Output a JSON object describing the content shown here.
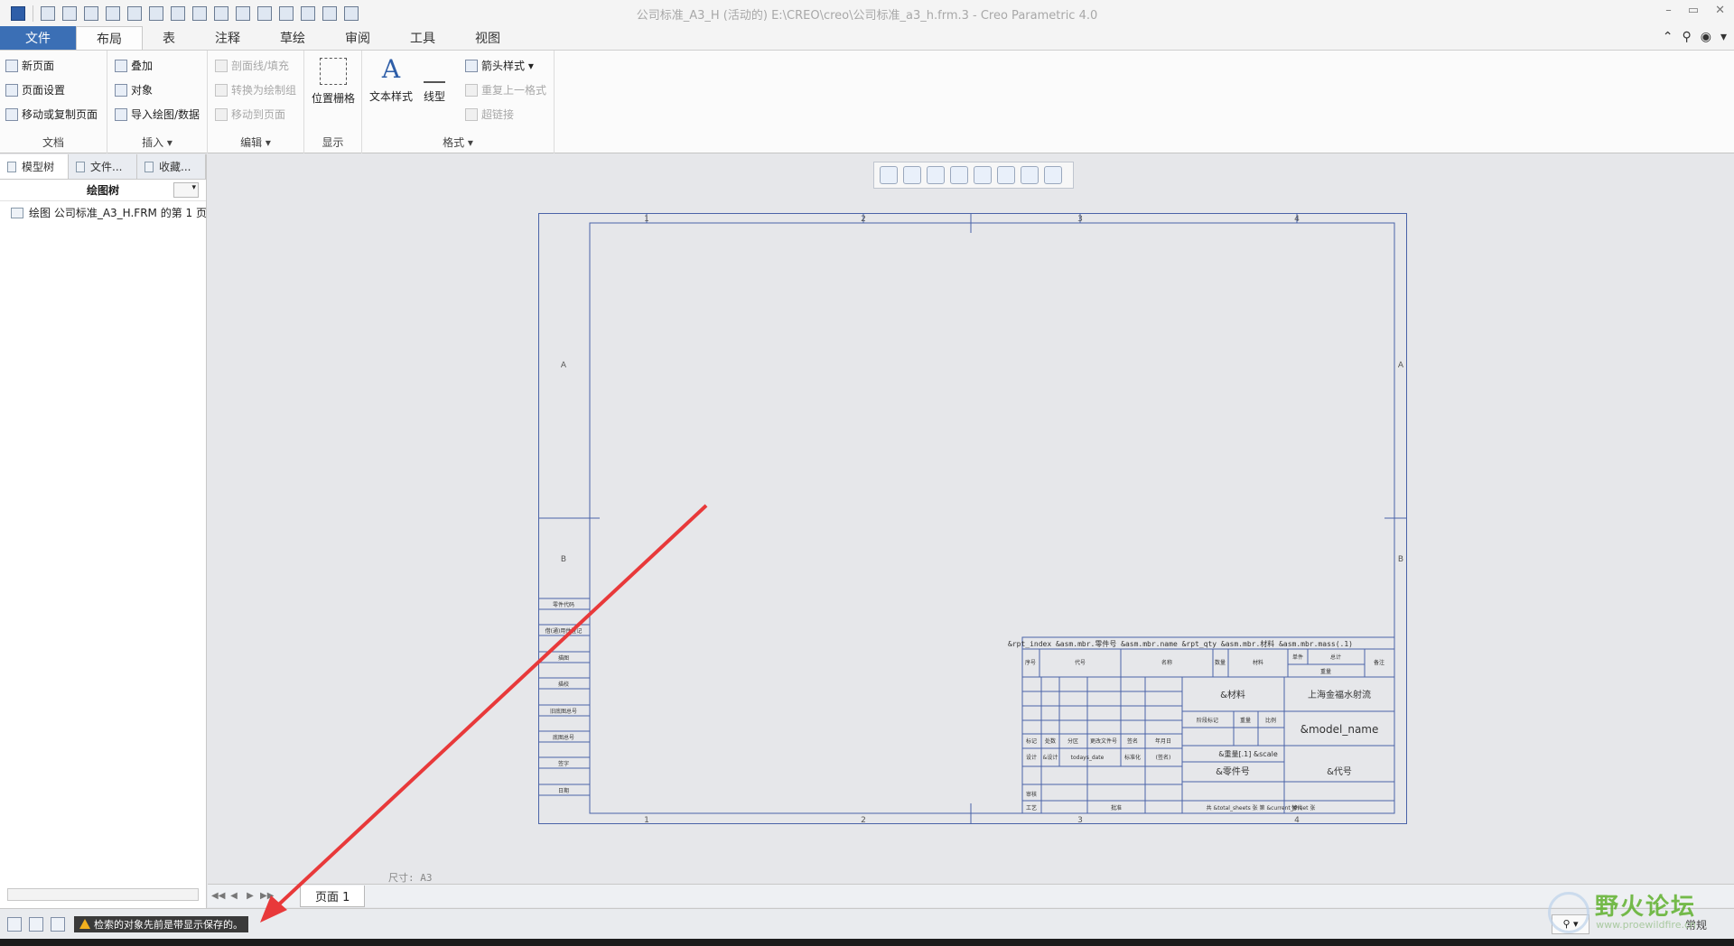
{
  "window": {
    "title": "公司标准_A3_H (活动的) E:\\CREO\\creo\\公司标准_a3_h.frm.3 - Creo Parametric 4.0",
    "buttons": [
      "–",
      "▭",
      "✕"
    ]
  },
  "tabs": [
    {
      "label": "文件"
    },
    {
      "label": "布局"
    },
    {
      "label": "表"
    },
    {
      "label": "注释"
    },
    {
      "label": "草绘"
    },
    {
      "label": "审阅"
    },
    {
      "label": "工具"
    },
    {
      "label": "视图"
    }
  ],
  "ribbon": {
    "doc": {
      "label": "文档",
      "new_page": "新页面",
      "page_setup": "页面设置",
      "move_copy": "移动或复制页面"
    },
    "insert": {
      "label": "插入",
      "overlay": "叠加",
      "object": "对象",
      "import": "导入绘图/数据"
    },
    "edit": {
      "label": "编辑",
      "hatch": "剖面线/填充",
      "convert": "转换为绘制组",
      "move_page": "移动到页面"
    },
    "display": {
      "label": "显示",
      "grid": "位置栅格"
    },
    "format": {
      "label": "格式",
      "text_style": "文本样式",
      "line_style": "线型",
      "arrow_style": "箭头样式",
      "repeat": "重复上一格式",
      "hyperlink": "超链接"
    }
  },
  "left_panel": {
    "tabs": [
      "模型树",
      "文件...",
      "收藏..."
    ],
    "header": "绘图树",
    "items": [
      "绘图 公司标准_A3_H.FRM 的第 1 页"
    ]
  },
  "drawing": {
    "col_top": [
      "1",
      "2",
      "3",
      "4"
    ],
    "col_bottom": [
      "1",
      "2",
      "3",
      "4"
    ],
    "row_left": [
      "A",
      "B"
    ],
    "row_right": [
      "A",
      "B"
    ],
    "side_table": [
      "零件代码",
      "借(通)用件登记",
      "描图",
      "描校",
      "旧底图总号",
      "底图总号",
      "签字",
      "日期"
    ],
    "bom_row": "&rpt_index &asm.mbr.零件号 &asm.mbr.name &rpt_qty &asm.mbr.材料 &asm.mbr.mass(.1)",
    "bom_header": [
      "序号",
      "代号",
      "名称",
      "数量",
      "材料",
      "单件",
      "总计",
      "备注"
    ],
    "bom_weight": "重量",
    "rev_header": [
      "标记",
      "处数",
      "分区",
      "更改文件号",
      "签名",
      "年月日"
    ],
    "design_row": [
      "设计",
      "&设计",
      "todays_date",
      "标准化",
      "(签名)"
    ],
    "review": "审核",
    "process": "工艺",
    "approve": "批准",
    "material": "&材料",
    "company": "上海金福水射流",
    "stage_mark": "阶段标记",
    "weight": "重量",
    "scale": "比例",
    "model_name": "&model_name",
    "mass_scale": "&重量[.1]  &scale",
    "part_no": "&零件号",
    "code": "&代号",
    "sheets": "共 &total_sheets 张  第 &current_sheet 张",
    "replace": "替代",
    "size": "尺寸: A3"
  },
  "pagebar": {
    "nav": [
      "◀◀",
      "◀",
      "▶",
      "▶▶"
    ],
    "page": "页面 1"
  },
  "statusbar": {
    "message": "检索的对象先前是带显示保存的。",
    "filter": "常规"
  },
  "watermark": {
    "main": "野火论坛",
    "sub": "www.proewildfire.cn"
  }
}
